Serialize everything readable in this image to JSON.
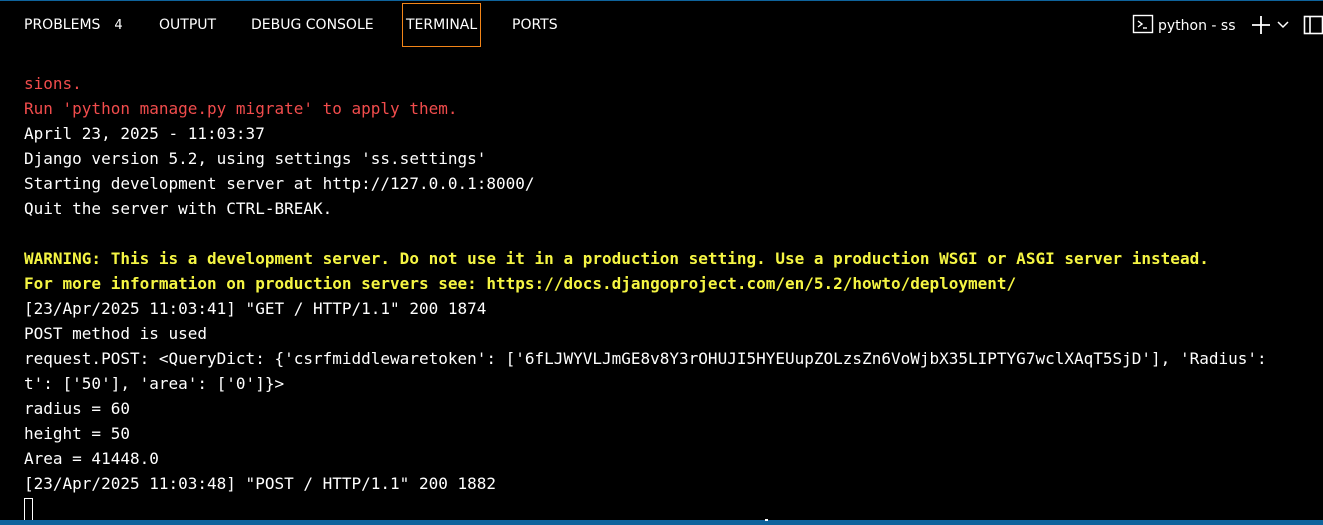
{
  "tabs": [
    {
      "label": "PROBLEMS",
      "badge": "4"
    },
    {
      "label": "OUTPUT"
    },
    {
      "label": "DEBUG CONSOLE"
    },
    {
      "label": "TERMINAL",
      "active": true
    },
    {
      "label": "PORTS"
    }
  ],
  "terminal_picker": {
    "label": "python - ss",
    "icon": "terminal-icon"
  },
  "actions": {
    "new_terminal_icon": "plus-icon",
    "dropdown_icon": "chevron-down-icon",
    "layout_icon": "layout-icon"
  },
  "colors": {
    "error_text": "#f14c4c",
    "warning_text": "#f5f543",
    "active_tab_border": "#f38518",
    "accent": "#0e639c"
  },
  "terminal": {
    "lines": [
      "sions.",
      "Run 'python manage.py migrate' to apply them.",
      "April 23, 2025 - 11:03:37",
      "Django version 5.2, using settings 'ss.settings'",
      "Starting development server at http://127.0.0.1:8000/",
      "Quit the server with CTRL-BREAK.",
      "",
      "WARNING: This is a development server. Do not use it in a production setting. Use a production WSGI or ASGI server instead.",
      "For more information on production servers see: https://docs.djangoproject.com/en/5.2/howto/deployment/",
      "[23/Apr/2025 11:03:41] \"GET / HTTP/1.1\" 200 1874",
      "POST method is used",
      "request.POST: <QueryDict: {'csrfmiddlewaretoken': ['6fLJWYVLJmGE8v8Y3rOHUJI5HYEUupZOLzsZn6VoWjbX35LIPTYG7wclXAqT5SjD'], 'Radius':",
      "t': ['50'], 'area': ['0']}>",
      "radius = 60",
      "height = 50",
      "Area = 41448.0",
      "[23/Apr/2025 11:03:48] \"POST / HTTP/1.1\" 200 1882"
    ]
  }
}
